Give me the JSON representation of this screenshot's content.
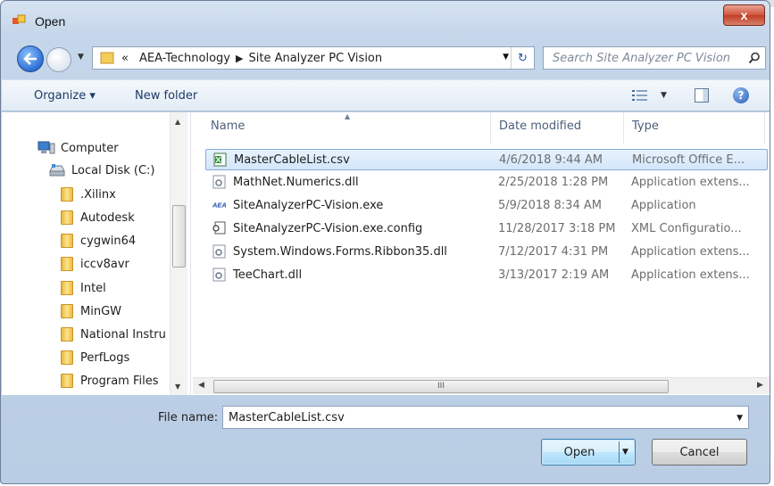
{
  "window": {
    "title": "Open",
    "close_label": "x"
  },
  "nav": {
    "breadcrumb": [
      "«",
      "AEA-Technology",
      "Site Analyzer PC Vision"
    ],
    "search_placeholder": "Search Site Analyzer PC Vision"
  },
  "toolbar": {
    "organize_label": "Organize ▾",
    "new_folder_label": "New folder"
  },
  "sidebar": {
    "items": [
      {
        "label": "Computer",
        "icon": "computer-icon"
      },
      {
        "label": "Local Disk (C:)",
        "icon": "disk-icon"
      },
      {
        "label": ".Xilinx",
        "icon": "folder-icon"
      },
      {
        "label": "Autodesk",
        "icon": "folder-icon"
      },
      {
        "label": "cygwin64",
        "icon": "folder-icon"
      },
      {
        "label": "iccv8avr",
        "icon": "folder-icon"
      },
      {
        "label": "Intel",
        "icon": "folder-icon"
      },
      {
        "label": "MinGW",
        "icon": "folder-icon"
      },
      {
        "label": "National Instru",
        "icon": "folder-icon"
      },
      {
        "label": "PerfLogs",
        "icon": "folder-icon"
      },
      {
        "label": "Program Files",
        "icon": "folder-icon"
      }
    ]
  },
  "list": {
    "columns": [
      "Name",
      "Date modified",
      "Type"
    ],
    "rows": [
      {
        "name": "MasterCableList.csv",
        "date": "4/6/2018 9:44 AM",
        "type": "Microsoft Office E...",
        "icon": "excel-icon",
        "selected": true
      },
      {
        "name": "MathNet.Numerics.dll",
        "date": "2/25/2018 1:28 PM",
        "type": "Application extens...",
        "icon": "dll-icon",
        "selected": false
      },
      {
        "name": "SiteAnalyzerPC-Vision.exe",
        "date": "5/9/2018 8:34 AM",
        "type": "Application",
        "icon": "aea-app-icon",
        "selected": false
      },
      {
        "name": "SiteAnalyzerPC-Vision.exe.config",
        "date": "11/28/2017 3:18 PM",
        "type": "XML Configuratio...",
        "icon": "config-icon",
        "selected": false
      },
      {
        "name": "System.Windows.Forms.Ribbon35.dll",
        "date": "7/12/2017 4:31 PM",
        "type": "Application extens...",
        "icon": "dll-icon",
        "selected": false
      },
      {
        "name": "TeeChart.dll",
        "date": "3/13/2017 2:19 AM",
        "type": "Application extens...",
        "icon": "dll-icon",
        "selected": false
      }
    ],
    "hscroll_grip": "III"
  },
  "footer": {
    "file_name_label": "File name:",
    "file_name_value": "MasterCableList.csv",
    "open_label": "Open",
    "cancel_label": "Cancel"
  }
}
